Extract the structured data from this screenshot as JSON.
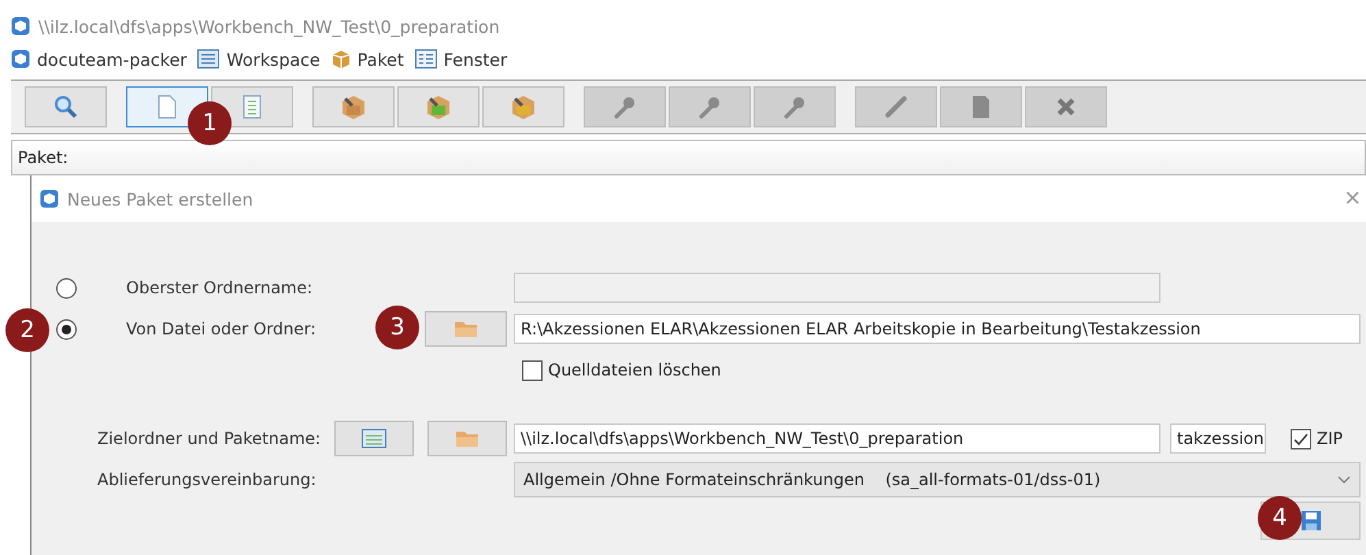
{
  "window": {
    "title": "\\\\ilz.local\\dfs\\apps\\Workbench_NW_Test\\0_preparation"
  },
  "menu": [
    {
      "label": "docuteam-packer",
      "kind": "app"
    },
    {
      "label": "Workspace",
      "kind": "workspace"
    },
    {
      "label": "Paket",
      "kind": "package"
    },
    {
      "label": "Fenster",
      "kind": "window"
    }
  ],
  "toolbar": [
    [
      {
        "kind": "search",
        "disabled": false,
        "selected": false
      }
    ],
    [
      {
        "kind": "new",
        "disabled": false,
        "selected": true
      },
      {
        "kind": "page",
        "disabled": false,
        "selected": false
      }
    ],
    [
      {
        "kind": "package",
        "disabled": false,
        "selected": false
      },
      {
        "kind": "package-green",
        "disabled": false,
        "selected": false
      },
      {
        "kind": "package-yellow",
        "disabled": false,
        "selected": false
      }
    ],
    [
      {
        "kind": "wrench",
        "disabled": true,
        "selected": false
      },
      {
        "kind": "wrench",
        "disabled": true,
        "selected": false
      },
      {
        "kind": "wrench",
        "disabled": true,
        "selected": false
      }
    ],
    [
      {
        "kind": "pencil",
        "disabled": true,
        "selected": false
      },
      {
        "kind": "sheet",
        "disabled": true,
        "selected": false
      },
      {
        "kind": "delete",
        "disabled": true,
        "selected": false
      }
    ]
  ],
  "package_label": "Paket:",
  "dialog": {
    "title": "Neues Paket erstellen",
    "close": "×",
    "source": [
      {
        "label": "Oberster Ordnername:",
        "selected": false,
        "disabled": true
      },
      {
        "label": "Von Datei oder Ordner:",
        "selected": true,
        "value": "R:\\Akzessionen ELAR\\Akzessionen ELAR Arbeitskopie in Bearbeitung\\Testakzession",
        "disabled": false
      }
    ],
    "delete_sources": {
      "label": "Quelldateien löschen",
      "checked": false
    },
    "target": {
      "label": "Zielordner und Paketname:",
      "folder": "\\\\ilz.local\\dfs\\apps\\Workbench_NW_Test\\0_preparation",
      "name": "takzession",
      "zip": {
        "label": "ZIP",
        "checked": true
      }
    },
    "agreement": {
      "label": "Ablieferungsvereinbarung:",
      "value": "Allgemein /Ohne Formateinschränkungen    (sa_all-formats-01/dss-01)"
    }
  },
  "badges": [
    "1",
    "2",
    "3",
    "4"
  ]
}
